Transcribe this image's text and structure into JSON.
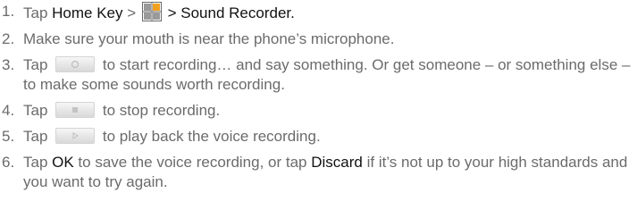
{
  "steps": [
    {
      "number": "1.",
      "parts": {
        "a": "Tap ",
        "b": "Home Key",
        "c": " > ",
        "d": " > Sound Recorder."
      },
      "icon": "apps-grid-icon"
    },
    {
      "number": "2.",
      "text": "Make sure your mouth is near the phone’s microphone."
    },
    {
      "number": "3.",
      "parts": {
        "a": "Tap ",
        "b": " to start recording… and say something. Or get someone – or something else – to make some sounds worth recording."
      },
      "icon": "record-button-icon"
    },
    {
      "number": "4.",
      "parts": {
        "a": "Tap ",
        "b": " to stop recording."
      },
      "icon": "stop-button-icon"
    },
    {
      "number": "5.",
      "parts": {
        "a": "Tap ",
        "b": " to play back the voice recording."
      },
      "icon": "play-button-icon"
    },
    {
      "number": "6.",
      "parts": {
        "a": "Tap ",
        "b": "OK",
        "c": " to save the voice recording, or tap ",
        "d": "Discard",
        "e": " if it’s not up to your high standards and you want to try again."
      }
    }
  ],
  "colors": {
    "text": "#6b6b6b",
    "emphasis": "#111111",
    "grid_accent": "#f0a020"
  }
}
